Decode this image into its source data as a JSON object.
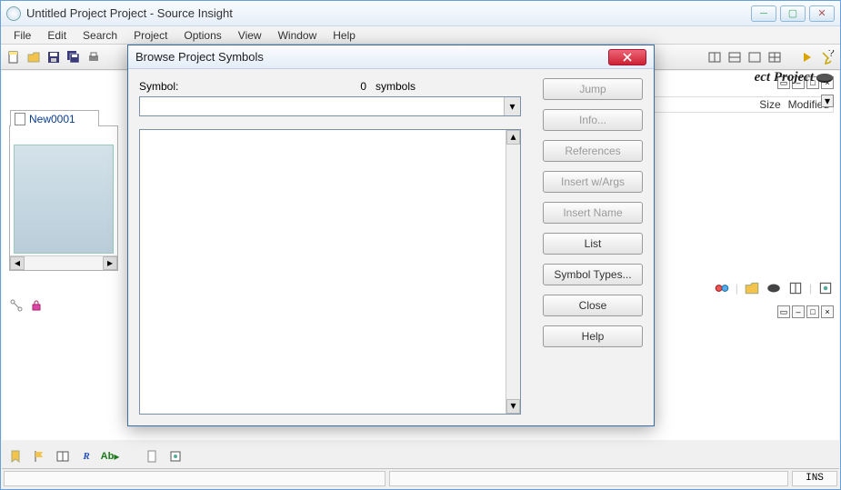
{
  "window": {
    "title": "Untitled Project Project - Source Insight"
  },
  "menu": {
    "file": "File",
    "edit": "Edit",
    "search": "Search",
    "project": "Project",
    "options": "Options",
    "view": "View",
    "window": "Window",
    "help": "Help"
  },
  "left_pane": {
    "tab_name": "New0001"
  },
  "right_pane": {
    "title": "ect Project",
    "col_size": "Size",
    "col_modified": "Modified"
  },
  "statusbar": {
    "ins": "INS"
  },
  "bottom_tb": {
    "ab": "Ab",
    "r": "R"
  },
  "dialog": {
    "title": "Browse Project Symbols",
    "symbol_label": "Symbol:",
    "count": "0",
    "count_label": "symbols",
    "input_value": "",
    "buttons": {
      "jump": "Jump",
      "info": "Info...",
      "references": "References",
      "insert_args": "Insert w/Args",
      "insert_name": "Insert Name",
      "list": "List",
      "symbol_types": "Symbol Types...",
      "close": "Close",
      "help": "Help"
    }
  }
}
